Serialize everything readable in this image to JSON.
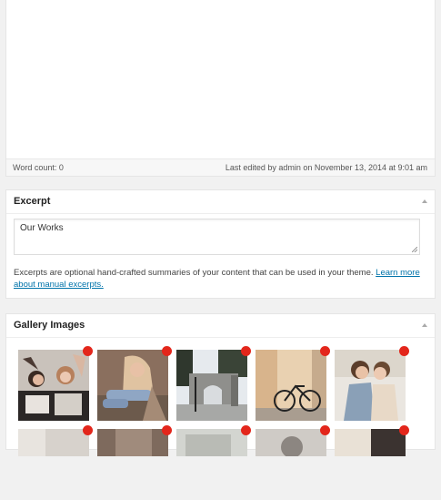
{
  "editor": {
    "word_count": "Word count: 0",
    "last_edited": "Last edited by admin on November 13, 2014 at 9:01 am"
  },
  "excerpt": {
    "title": "Excerpt",
    "value": "Our Works",
    "help_text": "Excerpts are optional hand-crafted summaries of your content that can be used in your theme.",
    "help_link": "Learn more about manual excerpts."
  },
  "gallery": {
    "title": "Gallery Images",
    "images": [
      {
        "subject": "friends-in-car-photo"
      },
      {
        "subject": "woman-sitting-photo"
      },
      {
        "subject": "stone-gate-street-photo"
      },
      {
        "subject": "bicycle-wall-photo"
      },
      {
        "subject": "couple-photo"
      },
      {
        "subject": "photo"
      },
      {
        "subject": "photo"
      },
      {
        "subject": "photo"
      },
      {
        "subject": "photo"
      },
      {
        "subject": "photo"
      }
    ],
    "remove_color": "#e3261b"
  }
}
